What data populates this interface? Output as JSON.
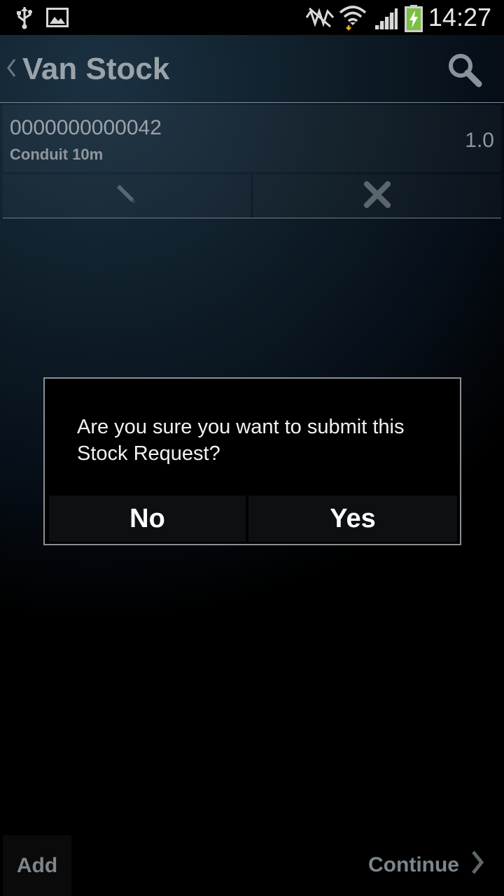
{
  "status_bar": {
    "time": "14:27",
    "icons": [
      "usb-icon",
      "image-notification-icon",
      "no-nfc-icon",
      "wifi-icon",
      "signal-icon",
      "battery-charging-icon"
    ],
    "battery_color": "#7bc043"
  },
  "action_bar": {
    "title": "Van Stock",
    "back_icon": "chevron-left-icon",
    "search_icon": "search-icon"
  },
  "list": {
    "items": [
      {
        "code": "0000000000042",
        "name": "Conduit 10m",
        "quantity": "1.0"
      }
    ],
    "actions": [
      "edit-icon",
      "delete-icon"
    ]
  },
  "dialog": {
    "message": "Are you sure you want to submit this Stock Request?",
    "no_label": "No",
    "yes_label": "Yes"
  },
  "bottom_bar": {
    "add_label": "Add",
    "continue_label": "Continue",
    "continue_icon": "chevron-right-icon"
  }
}
